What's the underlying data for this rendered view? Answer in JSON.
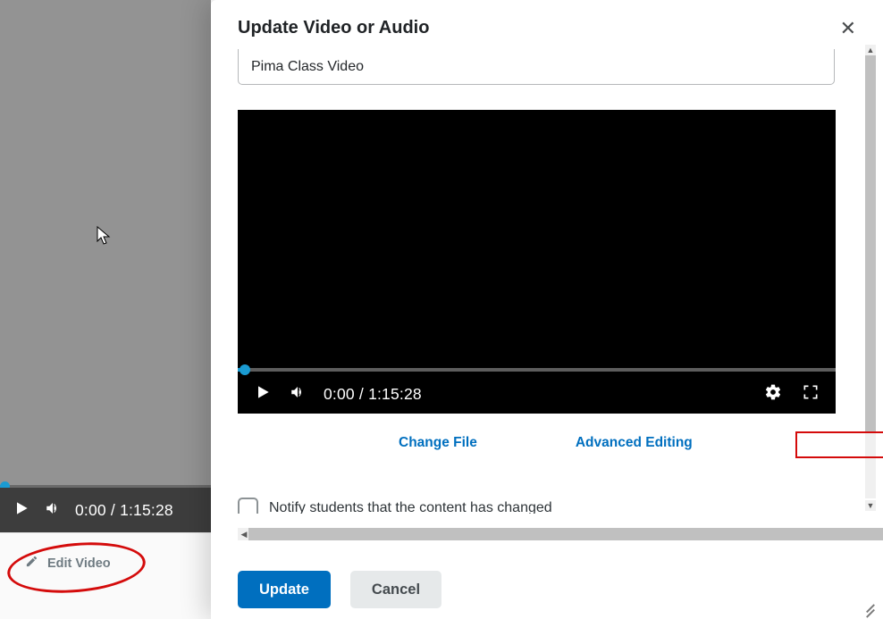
{
  "modal": {
    "title": "Update Video or Audio",
    "title_field_value": "Pima Class Video",
    "change_file_label": "Change File",
    "advanced_editing_label": "Advanced Editing",
    "notify_label": "Notify students that the content has changed",
    "update_button": "Update",
    "cancel_button": "Cancel"
  },
  "player": {
    "current_time": "0:00",
    "duration": "1:15:28"
  },
  "bg_player": {
    "current_time": "0:00",
    "duration": "1:15:28",
    "edit_video_label": "Edit Video"
  },
  "icons": {
    "play": "play-icon",
    "volume": "volume-icon",
    "gear": "gear-icon",
    "fullscreen": "fullscreen-icon",
    "close": "close-icon",
    "pencil": "pencil-icon"
  }
}
